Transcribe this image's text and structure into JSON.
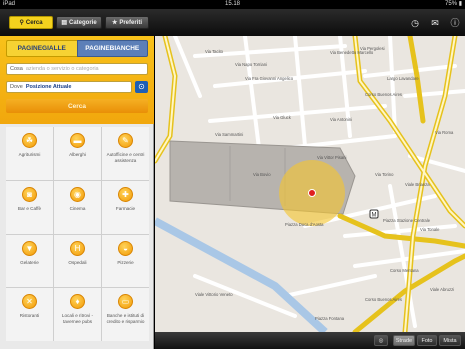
{
  "status": {
    "device": "iPad",
    "time": "15.18",
    "battery": "75% ▮"
  },
  "toolbar": {
    "search_tab": "Cerca",
    "categories_tab": "Categorie",
    "favorites_tab": "Preferiti"
  },
  "panel": {
    "brand_gialle": "PAGINEGIALLE",
    "brand_bianche": "PAGINEBIANCHE",
    "what": {
      "label": "Cosa",
      "placeholder": "azienda o servizio o categoria"
    },
    "where": {
      "label": "Dove",
      "value": "Posizione Attuale"
    },
    "search_button": "Cerca",
    "categories": [
      {
        "name": "Agriturismi",
        "icon": "☘"
      },
      {
        "name": "Alberghi",
        "icon": "▬"
      },
      {
        "name": "Autofficine e centri assistenza",
        "icon": "✎"
      },
      {
        "name": "Bar e Caffè",
        "icon": "◙"
      },
      {
        "name": "Cinema",
        "icon": "◉"
      },
      {
        "name": "Farmacie",
        "icon": "✚"
      },
      {
        "name": "Gelaterie",
        "icon": "▼"
      },
      {
        "name": "Ospedali",
        "icon": "H"
      },
      {
        "name": "Pizzerie",
        "icon": "◒"
      },
      {
        "name": "Ristoranti",
        "icon": "✕"
      },
      {
        "name": "Locali e ritrovi - tavernee pubs",
        "icon": "♦"
      },
      {
        "name": "Banche e istituti di credito e risparmio",
        "icon": "▭"
      }
    ]
  },
  "map": {
    "street_labels": [
      "Via Tacito",
      "Via Fra Giovanni Angelico",
      "Via Benedetto Marcello",
      "Via Napo Torriani",
      "Via Gluck",
      "Via Pergolesi",
      "Corso Buenos Aires",
      "Via Antonini",
      "Piazza Duca d'Aosta",
      "Via Vittor Pisani",
      "Via Torino",
      "Via Roma",
      "Largo Lavandare",
      "Viale Brianza",
      "Via Tonale",
      "Corso Mentana",
      "Viale Abruzzi",
      "Corso Buenos Aires",
      "Piazza Stazione Centrale",
      "Via Bovio",
      "Via Sammartini",
      "Viale Vittorio Veneto",
      "Piazza Fontana"
    ],
    "accent_color": "#f3c530"
  },
  "bottombar": {
    "strade": "Strade",
    "foto": "Foto",
    "mista": "Mista"
  }
}
